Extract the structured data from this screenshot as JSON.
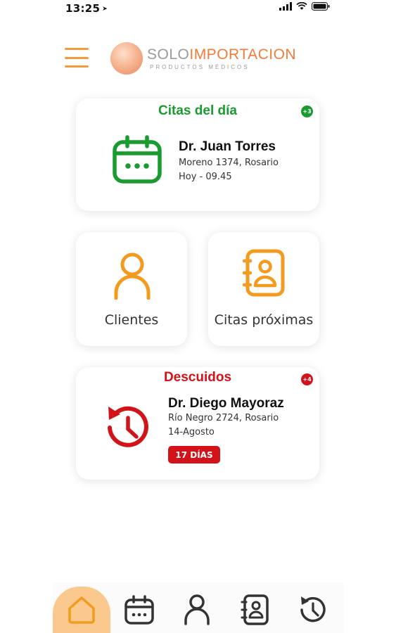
{
  "status": {
    "time": "13:25"
  },
  "header": {
    "logo": {
      "part1": "SOLO",
      "part2": "IMPORTACION",
      "sub": "PRODUCTOS MÉDICOS"
    }
  },
  "today": {
    "title": "Citas del día",
    "badge": "+3",
    "name": "Dr. Juan Torres",
    "address": "Moreno 1374, Rosario",
    "when": "Hoy - 09.45",
    "icon": "calendar-icon",
    "color": "#1a9b2f"
  },
  "tiles": {
    "clients_label": "Clientes",
    "upcoming_label": "Citas próximas",
    "color": "#f39a1f"
  },
  "neglected": {
    "title": "Descuidos",
    "badge": "+4",
    "name": "Dr. Diego Mayoraz",
    "address": "Río Negro 2724, Rosario",
    "date": "14-Agosto",
    "days": "17 DÍAS",
    "icon": "history-icon",
    "color": "#d3131a"
  },
  "nav": {
    "items": [
      "home-icon",
      "calendar-icon",
      "user-icon",
      "contacts-icon",
      "history-icon"
    ],
    "active": "home-icon",
    "accent": "#fbc98d"
  }
}
